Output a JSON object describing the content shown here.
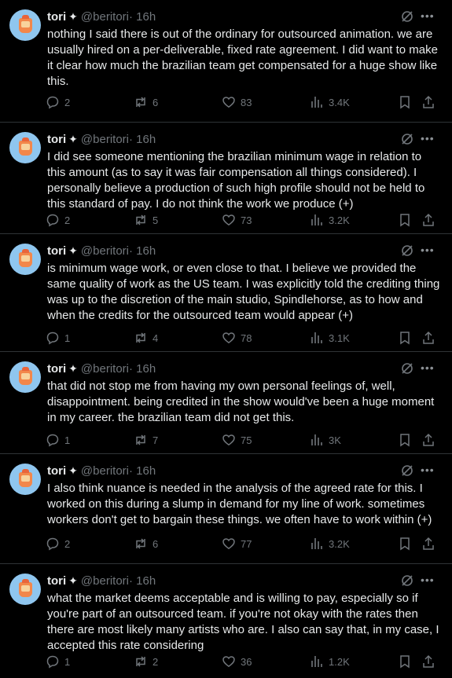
{
  "tweets": [
    {
      "name": "tori",
      "handle": "@beritori",
      "time": "· 16h",
      "text": "nothing I said there is out of the ordinary for outsourced animation. we are usually hired on a per-deliverable, fixed rate agreement. I did want to make it clear how much the brazilian team get compensated for a huge show like this.",
      "replies": "2",
      "reposts": "6",
      "likes": "83",
      "views": "3.4K"
    },
    {
      "name": "tori",
      "handle": "@beritori",
      "time": "· 16h",
      "text": "I did see someone mentioning the brazilian minimum wage in relation to this amount (as to say it was fair compensation all things considered). I personally believe a production of such high profile should not be held to this standard of pay. I do not think the work we produce (+)",
      "replies": "2",
      "reposts": "5",
      "likes": "73",
      "views": "3.2K"
    },
    {
      "name": "tori",
      "handle": "@beritori",
      "time": "· 16h",
      "text": "is minimum wage work, or even close to that. I believe we provided the same quality of work as the US team. I was explicitly told the crediting thing was up to the discretion of the main studio, Spindlehorse, as to how and when the credits for the outsourced team would appear (+)",
      "replies": "1",
      "reposts": "4",
      "likes": "78",
      "views": "3.1K"
    },
    {
      "name": "tori",
      "handle": "@beritori",
      "time": "· 16h",
      "text": "that did not stop me from having my own personal feelings of, well, disappointment. being credited in the show would've been a huge moment in my career. the brazilian team did not get this.",
      "replies": "1",
      "reposts": "7",
      "likes": "75",
      "views": "3K"
    },
    {
      "name": "tori",
      "handle": "@beritori",
      "time": "· 16h",
      "text": "I also think nuance is needed in the analysis of the agreed rate for this. I worked on this during a slump in demand for my line of work. sometimes workers don't get to bargain these things. we often have to work within (+)",
      "replies": "2",
      "reposts": "6",
      "likes": "77",
      "views": "3.2K"
    },
    {
      "name": "tori",
      "handle": "@beritori",
      "time": "· 16h",
      "text": "what the market deems acceptable and is willing to pay, especially so if you're part of an outsourced team. if you're not okay with the rates then there are most likely many artists who are. I also can say that, in my case, I accepted this rate considering",
      "replies": "1",
      "reposts": "2",
      "likes": "36",
      "views": "1.2K"
    }
  ],
  "colors": {
    "background": "#000000",
    "text": "#e7e9ea",
    "muted": "#71767b",
    "divider": "#2f3336"
  },
  "icons": {
    "badge": "sparkle-icon",
    "grok": "grok-icon",
    "more": "more-icon",
    "reply": "reply-icon",
    "repost": "repost-icon",
    "like": "heart-icon",
    "views": "views-icon",
    "bookmark": "bookmark-icon",
    "share": "share-icon"
  }
}
